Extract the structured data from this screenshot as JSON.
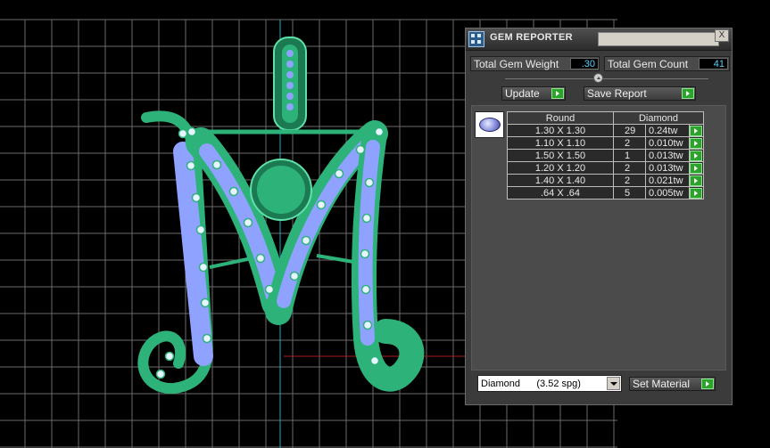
{
  "colors": {
    "background": "#000000",
    "grid": "#6b6b6b",
    "metal": "#2db37a",
    "gem": "#8fa2ff",
    "panel": "#3b3b3b",
    "value_text": "#59d2ff",
    "accent_button": "#2da32d"
  },
  "panel": {
    "title": "GEM REPORTER",
    "close_label": "X",
    "total_weight_label": "Total Gem Weight",
    "total_weight_value": ".30",
    "total_count_label": "Total Gem Count",
    "total_count_value": "41",
    "update_label": "Update",
    "save_report_label": "Save Report",
    "gem_shape_icon": "round-diamond-icon",
    "table": {
      "headers": [
        "Round",
        "Diamond"
      ],
      "rows": [
        {
          "size": "1.30 X 1.30",
          "count": "29",
          "weight": "0.24tw"
        },
        {
          "size": "1.10 X 1.10",
          "count": "2",
          "weight": "0.010tw"
        },
        {
          "size": "1.50 X 1.50",
          "count": "1",
          "weight": "0.013tw"
        },
        {
          "size": "1.20 X 1.20",
          "count": "2",
          "weight": "0.013tw"
        },
        {
          "size": "1.40 X 1.40",
          "count": "2",
          "weight": "0.021tw"
        },
        {
          "size": ".64 X .64",
          "count": "5",
          "weight": "0.005tw"
        }
      ]
    },
    "material_select": "Diamond      (3.52 spg)",
    "set_material_label": "Set Material"
  }
}
